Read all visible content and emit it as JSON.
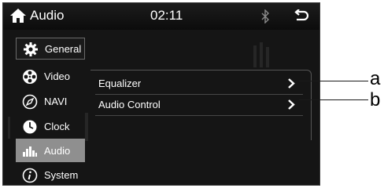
{
  "header": {
    "title": "Audio",
    "time": "02:11",
    "icons": {
      "home": "home-icon",
      "bluetooth": "bluetooth-icon",
      "back": "back-icon"
    }
  },
  "sidebar": {
    "items": [
      {
        "label": "General",
        "icon": "gear-icon"
      },
      {
        "label": "Video",
        "icon": "film-reel-icon"
      },
      {
        "label": "NAVI",
        "icon": "compass-icon"
      },
      {
        "label": "Clock",
        "icon": "clock-icon"
      },
      {
        "label": "Audio",
        "icon": "equalizer-icon",
        "active": true
      },
      {
        "label": "System",
        "icon": "info-icon"
      }
    ]
  },
  "main": {
    "items": [
      {
        "label": "Equalizer",
        "icon": "chevron-right-icon"
      },
      {
        "label": "Audio Control",
        "icon": "chevron-right-icon"
      }
    ]
  },
  "callouts": [
    "a",
    "b"
  ],
  "colors": {
    "screen_bg": "#151515",
    "active_item": "#8f8f8f",
    "text": "#ffffff"
  }
}
